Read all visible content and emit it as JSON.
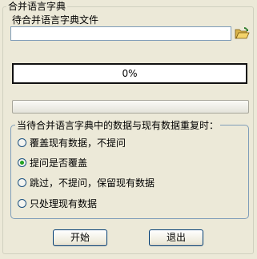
{
  "group": {
    "title": "合并语言字典"
  },
  "file": {
    "label": "待合并语言字典文件",
    "value": "",
    "folder_icon": "open-folder-icon"
  },
  "progress": {
    "text": "0%",
    "value": 0
  },
  "conflict": {
    "title": "当待合并语言字典中的数据与现有数据重复时：",
    "options": [
      {
        "label": "覆盖现有数据，不提问",
        "checked": false
      },
      {
        "label": "提问是否覆盖",
        "checked": true
      },
      {
        "label": "跳过，不提问，保留现有数据",
        "checked": false
      },
      {
        "label": "只处理现有数据",
        "checked": false
      }
    ]
  },
  "buttons": {
    "start": "开始",
    "exit": "退出"
  },
  "colors": {
    "accent_check": "#21a121",
    "border_blue": "#7f9db9"
  }
}
